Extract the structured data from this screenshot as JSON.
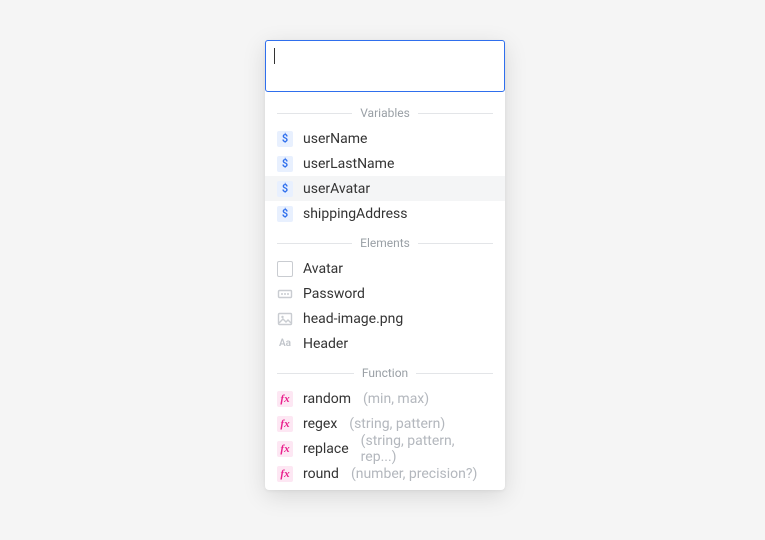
{
  "input": {
    "value": ""
  },
  "sections": {
    "variables": {
      "title": "Variables",
      "items": [
        "userName",
        "userLastName",
        "userAvatar",
        "shippingAddress"
      ]
    },
    "elements": {
      "title": "Elements",
      "items": [
        "Avatar",
        "Password",
        "head-image.png",
        "Header"
      ]
    },
    "functions": {
      "title": "Function",
      "items": [
        {
          "name": "random",
          "args": "(min, max)"
        },
        {
          "name": "regex",
          "args": "(string, pattern)"
        },
        {
          "name": "replace",
          "args": "(string, pattern, rep...)"
        },
        {
          "name": "round",
          "args": "(number, precision?)"
        }
      ]
    }
  },
  "highlighted": "userAvatar"
}
